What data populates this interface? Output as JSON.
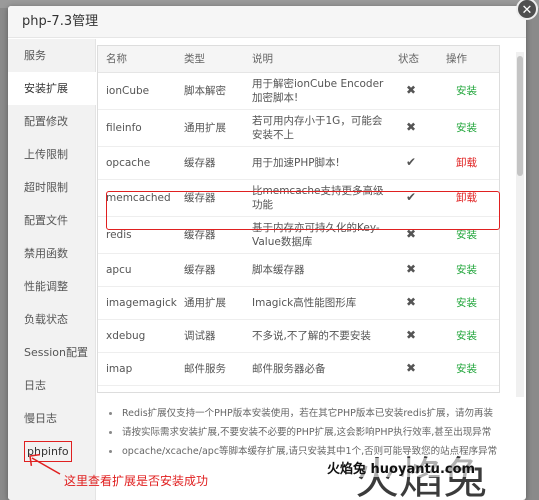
{
  "dialog": {
    "title": "php-7.3管理",
    "close": "✕"
  },
  "sidebar": {
    "items": [
      {
        "label": "服务"
      },
      {
        "label": "安装扩展"
      },
      {
        "label": "配置修改"
      },
      {
        "label": "上传限制"
      },
      {
        "label": "超时限制"
      },
      {
        "label": "配置文件"
      },
      {
        "label": "禁用函数"
      },
      {
        "label": "性能调整"
      },
      {
        "label": "负载状态"
      },
      {
        "label": "Session配置"
      },
      {
        "label": "日志"
      },
      {
        "label": "慢日志"
      },
      {
        "label": "phpinfo"
      }
    ],
    "active_index": 1
  },
  "table": {
    "headers": [
      "名称",
      "类型",
      "说明",
      "状态",
      "操作"
    ],
    "rows": [
      {
        "name": "ionCube",
        "type": "脚本解密",
        "desc": "用于解密ionCube Encoder加密脚本!",
        "status": "✖",
        "op": "安装",
        "op_kind": "install"
      },
      {
        "name": "fileinfo",
        "type": "通用扩展",
        "desc": "若可用内存小于1G，可能会安装不上",
        "status": "✖",
        "op": "安装",
        "op_kind": "install"
      },
      {
        "name": "opcache",
        "type": "缓存器",
        "desc": "用于加速PHP脚本!",
        "status": "✔",
        "op": "卸载",
        "op_kind": "uninstall"
      },
      {
        "name": "memcached",
        "type": "缓存器",
        "desc": "比memcache支持更多高级功能",
        "status": "✔",
        "op": "卸载",
        "op_kind": "uninstall"
      },
      {
        "name": "redis",
        "type": "缓存器",
        "desc": "基于内存亦可持久化的Key-Value数据库",
        "status": "✖",
        "op": "安装",
        "op_kind": "install"
      },
      {
        "name": "apcu",
        "type": "缓存器",
        "desc": "脚本缓存器",
        "status": "✖",
        "op": "安装",
        "op_kind": "install"
      },
      {
        "name": "imagemagick",
        "type": "通用扩展",
        "desc": "Imagick高性能图形库",
        "status": "✖",
        "op": "安装",
        "op_kind": "install"
      },
      {
        "name": "xdebug",
        "type": "调试器",
        "desc": "不多说,不了解的不要安装",
        "status": "✖",
        "op": "安装",
        "op_kind": "install"
      },
      {
        "name": "imap",
        "type": "邮件服务",
        "desc": "邮件服务器必备",
        "status": "✖",
        "op": "安装",
        "op_kind": "install"
      }
    ]
  },
  "notes": [
    "Redis扩展仅支持一个PHP版本安装使用，若在其它PHP版本已安装redis扩展，请勿再装",
    "请按实际需求安装扩展,不要安装不必要的PHP扩展,这会影响PHP执行效率,甚至出现异常",
    "opcache/xcache/apc等脚本缓存扩展,请只安装其中1个,否则可能导致您的站点程序异常"
  ],
  "annotation": "这里查看扩展是否安装成功",
  "watermark": {
    "small": "火焰兔 huoyantu.com",
    "big": "火焰兔"
  },
  "colors": {
    "install": "#20a53a",
    "uninstall": "#e02020",
    "highlight": "#e02020"
  }
}
